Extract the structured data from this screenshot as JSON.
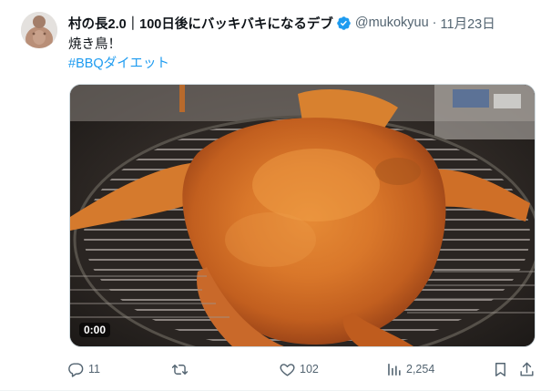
{
  "post": {
    "author": {
      "display_name": "村の長2.0｜100日後にバッキバキになるデブ",
      "handle": "@mukokyuu",
      "separator": "·",
      "date": "11月23日",
      "verified_icon": "verified-badge-icon"
    },
    "text": {
      "line1": "焼き鳥！",
      "hashtag": "#BBQダイエット"
    },
    "media": {
      "type": "video",
      "timestamp": "0:00"
    },
    "actions": {
      "reply_count": "11",
      "retweet_count": "",
      "like_count": "102",
      "views_count": "2,254"
    }
  },
  "colors": {
    "accent": "#1d9bf0",
    "secondary_text": "#536471",
    "primary_text": "#0f1419"
  }
}
